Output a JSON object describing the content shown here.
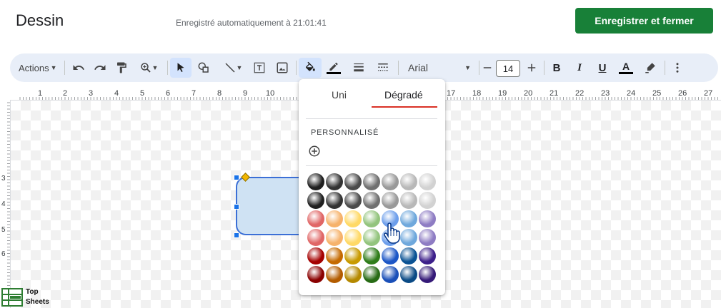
{
  "header": {
    "title": "Dessin",
    "autosave": "Enregistré automatiquement à 21:01:41",
    "save_button": "Enregistrer et fermer"
  },
  "toolbar": {
    "actions_label": "Actions",
    "font_name": "Arial",
    "font_size": "14",
    "icons": [
      "undo-icon",
      "redo-icon",
      "paint-format-icon",
      "zoom-icon",
      "select-icon",
      "shape-icon",
      "line-icon",
      "textbox-icon",
      "image-icon",
      "fill-color-icon",
      "border-color-icon",
      "border-weight-icon",
      "border-dash-icon",
      "decrease-size-icon",
      "increase-size-icon",
      "bold-icon",
      "italic-icon",
      "underline-icon",
      "text-color-icon",
      "highlight-icon",
      "more-icon"
    ]
  },
  "ruler": {
    "h_labels": [
      "1",
      "2",
      "3",
      "4",
      "5",
      "6",
      "7",
      "8",
      "9",
      "10",
      "17",
      "18",
      "19",
      "20",
      "21",
      "22",
      "23",
      "24",
      "25",
      "26",
      "27"
    ],
    "v_labels": [
      "3",
      "4",
      "5",
      "6"
    ]
  },
  "fill_popup": {
    "tab_solid": "Uni",
    "tab_gradient": "Dégradé",
    "active_tab": "Dégradé",
    "custom_label": "PERSONNALISÉ",
    "add_icon": "add-circle-icon",
    "gradient_rows": [
      [
        "#1f1f1f",
        "#333333",
        "#4a4a4a",
        "#707070",
        "#999999",
        "#b8b8b8",
        "#d2d2d2"
      ],
      [
        "#1f1f1f",
        "#333333",
        "#4a4a4a",
        "#707070",
        "#999999",
        "#b8b8b8",
        "#d2d2d2"
      ],
      [
        "#e06666",
        "#f6b26b",
        "#ffd966",
        "#93c47d",
        "#6d9eeb",
        "#6fa8dc",
        "#8e7cc3"
      ],
      [
        "#e06666",
        "#f6b26b",
        "#ffd966",
        "#93c47d",
        "#6d9eeb",
        "#6fa8dc",
        "#8e7cc3"
      ],
      [
        "#a50000",
        "#c56a00",
        "#c89a00",
        "#2f7d1a",
        "#1c56c6",
        "#0b5394",
        "#3d1f8a"
      ],
      [
        "#8a0000",
        "#b35c00",
        "#b58900",
        "#276b14",
        "#1a4fb8",
        "#0a4a85",
        "#351a78"
      ]
    ]
  },
  "watermark": {
    "line1": "Top",
    "line2": "Sheets"
  }
}
